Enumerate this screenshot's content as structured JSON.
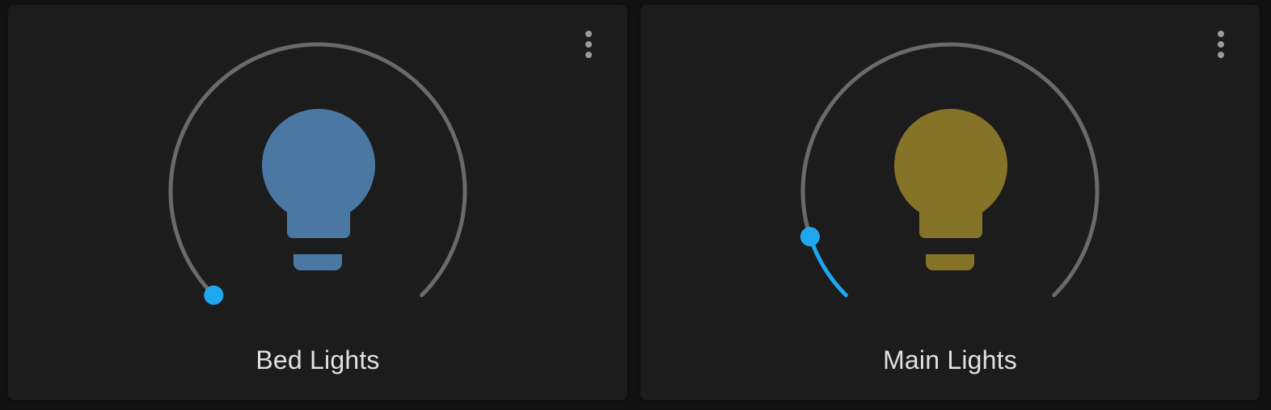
{
  "cards": [
    {
      "name": "Bed Lights",
      "brightness_fraction": 0.0,
      "bulb_color": "#4a78a2",
      "icon": "lightbulb-icon",
      "menu_icon": "dots-vertical-icon"
    },
    {
      "name": "Main Lights",
      "brightness_fraction": 0.1,
      "bulb_color": "#857328",
      "icon": "lightbulb-icon",
      "menu_icon": "dots-vertical-icon"
    }
  ],
  "colors": {
    "card_background": "#1c1c1c",
    "page_background": "#111111",
    "track": "#6a6a6a",
    "accent": "#1fa7ef",
    "title_text": "#e1e1e1",
    "menu_dots": "#9b9b9b"
  }
}
